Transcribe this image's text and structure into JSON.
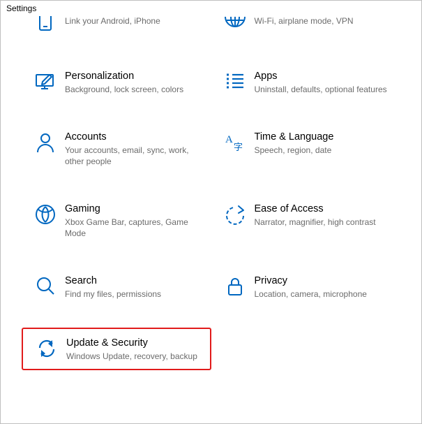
{
  "window": {
    "title": "Settings"
  },
  "tiles": {
    "phone": {
      "label": "",
      "desc": "Link your Android, iPhone"
    },
    "network": {
      "label": "",
      "desc": "Wi-Fi, airplane mode, VPN"
    },
    "personal": {
      "label": "Personalization",
      "desc": "Background, lock screen, colors"
    },
    "apps": {
      "label": "Apps",
      "desc": "Uninstall, defaults, optional features"
    },
    "accounts": {
      "label": "Accounts",
      "desc": "Your accounts, email, sync, work, other people"
    },
    "time": {
      "label": "Time & Language",
      "desc": "Speech, region, date"
    },
    "gaming": {
      "label": "Gaming",
      "desc": "Xbox Game Bar, captures, Game Mode"
    },
    "ease": {
      "label": "Ease of Access",
      "desc": "Narrator, magnifier, high contrast"
    },
    "search": {
      "label": "Search",
      "desc": "Find my files, permissions"
    },
    "privacy": {
      "label": "Privacy",
      "desc": "Location, camera, microphone"
    },
    "update": {
      "label": "Update & Security",
      "desc": "Windows Update, recovery, backup"
    }
  },
  "colors": {
    "icon": "#0067c0"
  }
}
